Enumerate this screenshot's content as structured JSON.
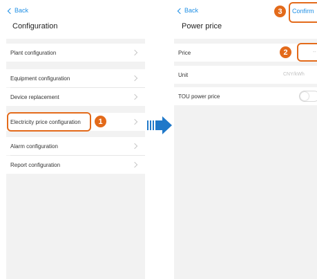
{
  "left_screen": {
    "back_label": "Back",
    "title": "Configuration",
    "items": [
      {
        "label": "Plant configuration"
      },
      {
        "label": "Equipment configuration"
      },
      {
        "label": "Device replacement"
      },
      {
        "label": "Electricity price configuration"
      },
      {
        "label": "Alarm configuration"
      },
      {
        "label": "Report configuration"
      }
    ]
  },
  "right_screen": {
    "back_label": "Back",
    "title": "Power price",
    "confirm_label": "Confirm",
    "price": {
      "label": "Price",
      "value": "--"
    },
    "unit": {
      "label": "Unit",
      "value": "CNY/kWh"
    },
    "tou": {
      "label": "TOU power price",
      "enabled": false
    }
  },
  "callouts": {
    "one": "1",
    "two": "2",
    "three": "3"
  },
  "colors": {
    "accent": "#e36a1a",
    "link": "#1f8fe5",
    "arrow": "#1f78c9"
  }
}
